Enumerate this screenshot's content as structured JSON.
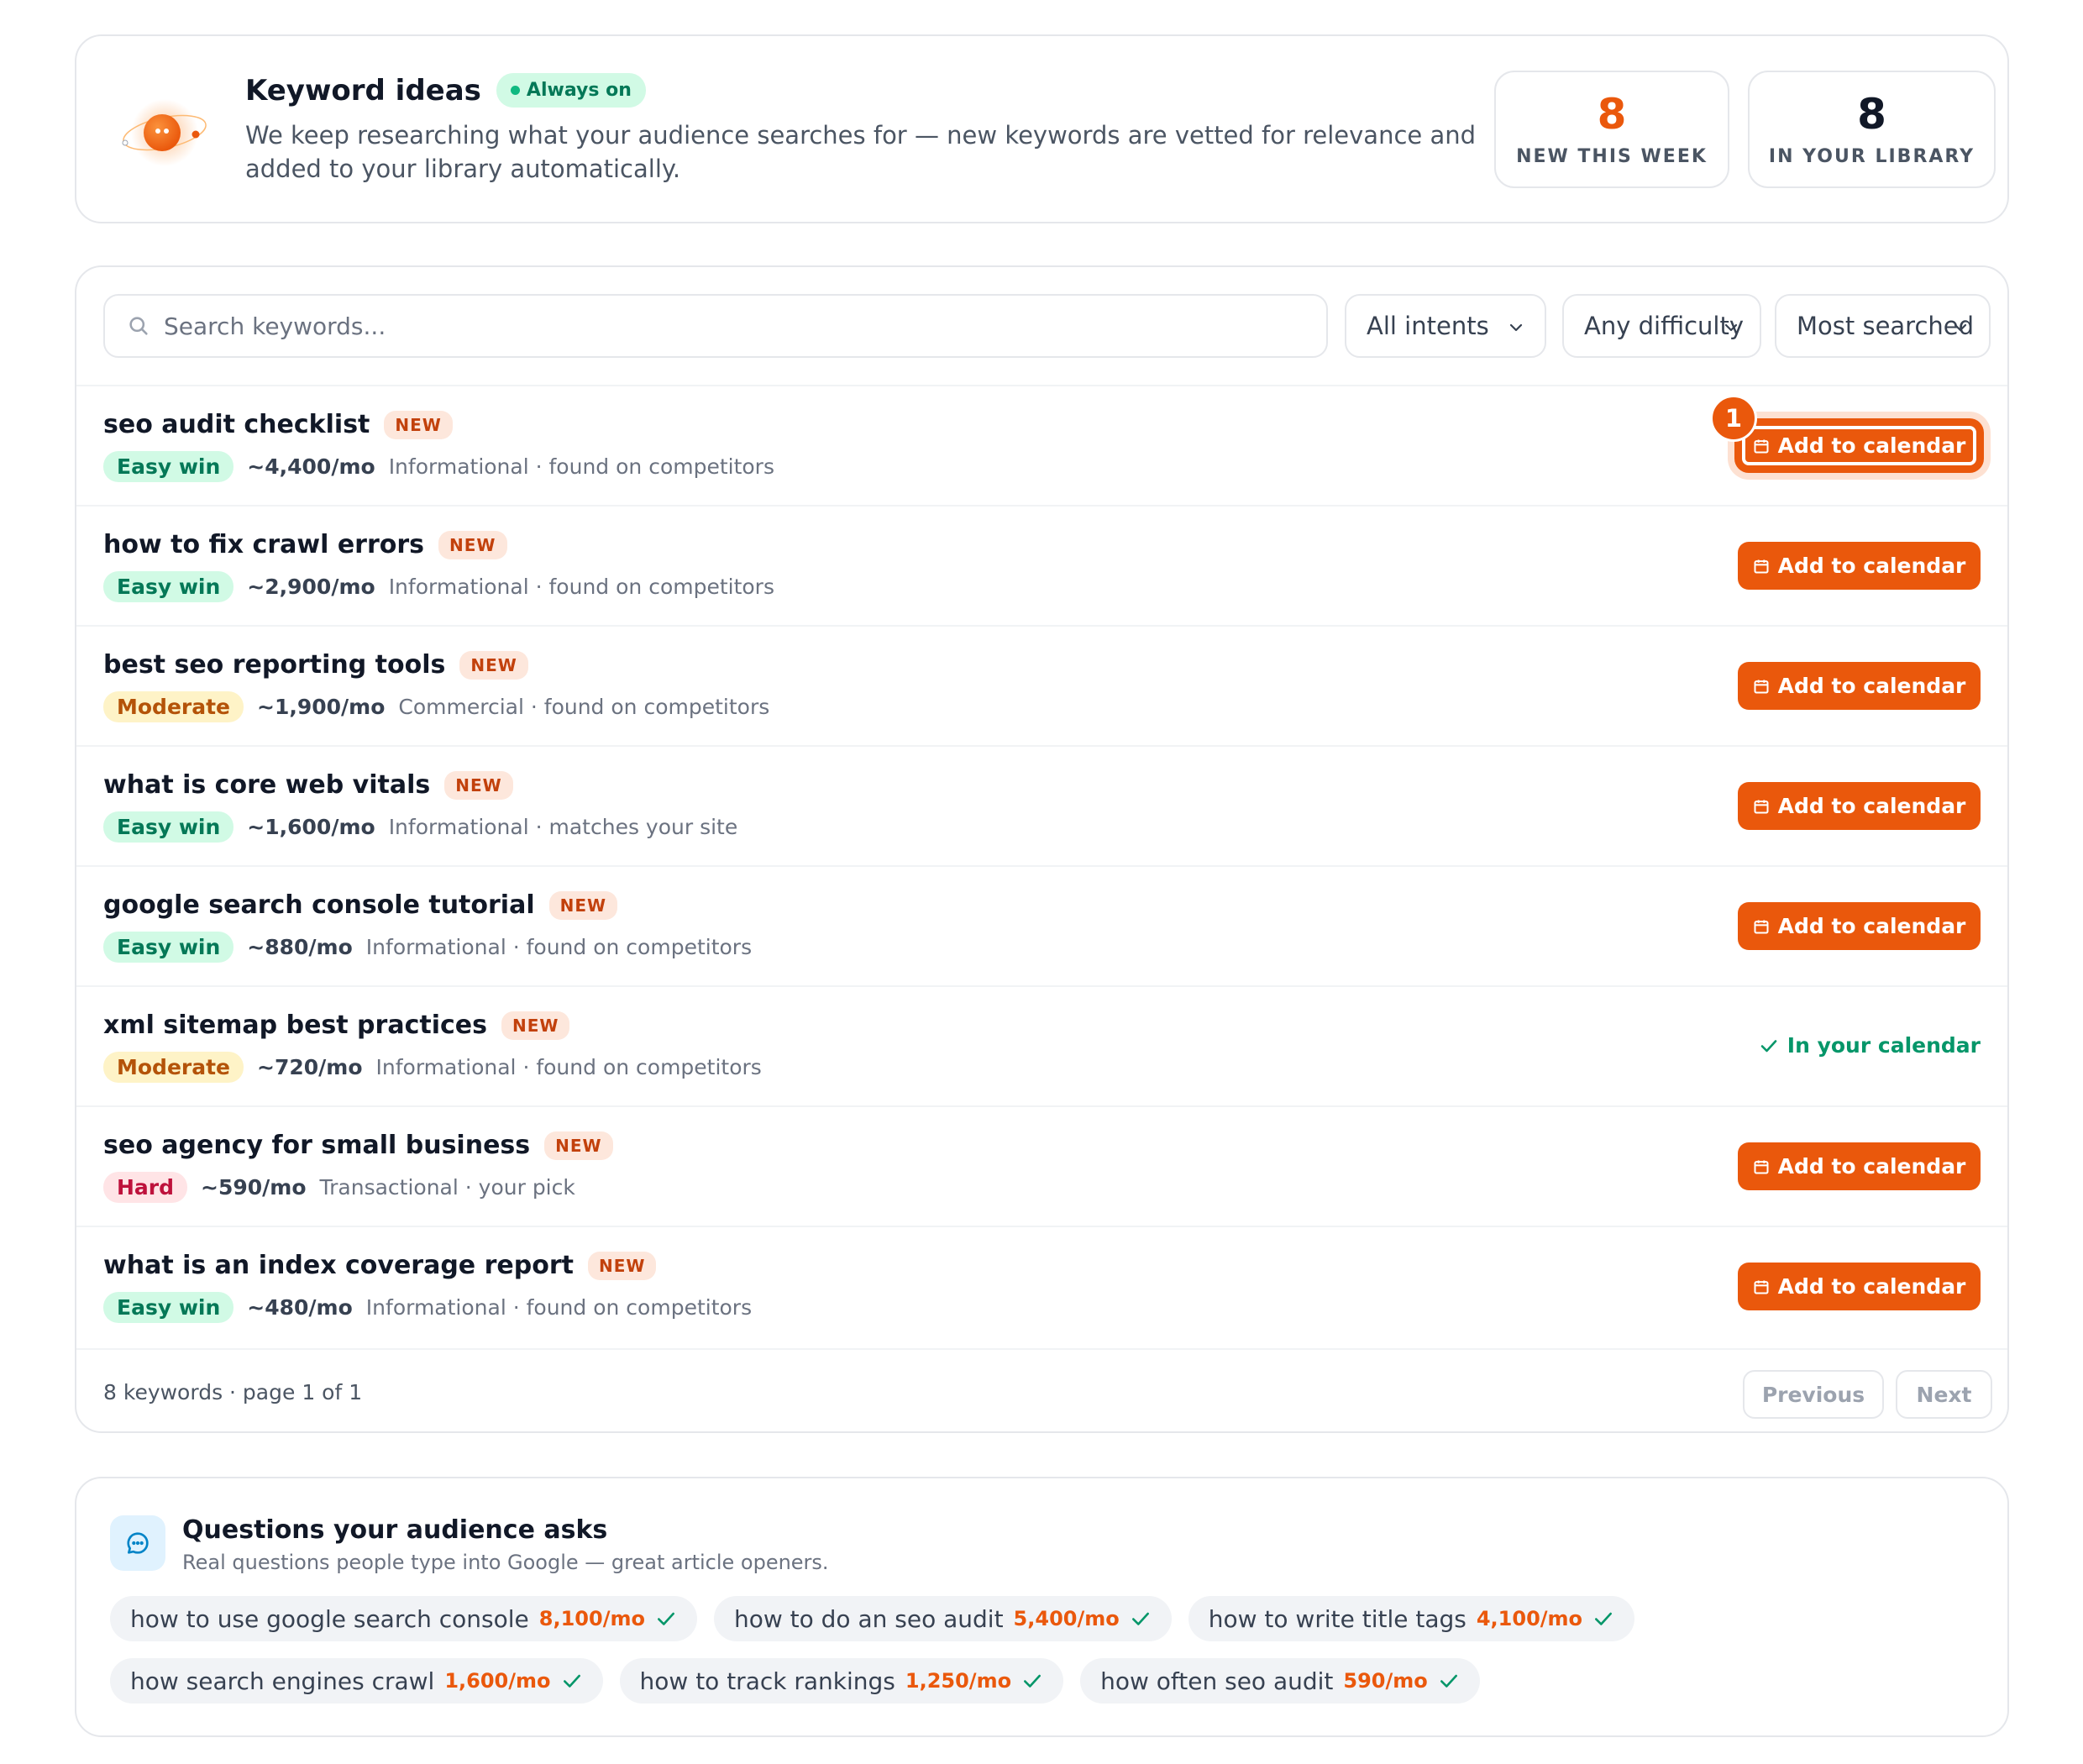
{
  "header": {
    "title": "Keyword ideas",
    "status_pill": "Always on",
    "description": "We keep researching what your audience searches for — new keywords are vetted for relevance and added to your library automatically.",
    "stats": [
      {
        "value": "8",
        "label": "NEW THIS WEEK",
        "color": "#ea580c"
      },
      {
        "value": "8",
        "label": "IN YOUR LIBRARY",
        "color": "#111827"
      }
    ]
  },
  "filters": {
    "search_placeholder": "Search keywords...",
    "intent": "All intents",
    "difficulty": "Any difficulty",
    "sort": "Most searched"
  },
  "keywords": [
    {
      "keyword": "seo audit checklist",
      "tag": "NEW",
      "difficulty": "Easy win",
      "level": "easy",
      "volume": "~4,400/mo",
      "meta": "Informational · found on competitors",
      "action": "Add to calendar",
      "badge": "1"
    },
    {
      "keyword": "how to fix crawl errors",
      "tag": "NEW",
      "difficulty": "Easy win",
      "level": "easy",
      "volume": "~2,900/mo",
      "meta": "Informational · found on competitors",
      "action": "Add to calendar"
    },
    {
      "keyword": "best seo reporting tools",
      "tag": "NEW",
      "difficulty": "Moderate",
      "level": "moderate",
      "volume": "~1,900/mo",
      "meta": "Commercial · found on competitors",
      "action": "Add to calendar"
    },
    {
      "keyword": "what is core web vitals",
      "tag": "NEW",
      "difficulty": "Easy win",
      "level": "easy",
      "volume": "~1,600/mo",
      "meta": "Informational · matches your site",
      "action": "Add to calendar"
    },
    {
      "keyword": "google search console tutorial",
      "tag": "NEW",
      "difficulty": "Easy win",
      "level": "easy",
      "volume": "~880/mo",
      "meta": "Informational · found on competitors",
      "action": "Add to calendar"
    },
    {
      "keyword": "xml sitemap best practices",
      "tag": "NEW",
      "difficulty": "Moderate",
      "level": "moderate",
      "volume": "~720/mo",
      "meta": "Informational · found on competitors",
      "status": "In your calendar"
    },
    {
      "keyword": "seo agency for small business",
      "tag": "NEW",
      "difficulty": "Hard",
      "level": "hard",
      "volume": "~590/mo",
      "meta": "Transactional · your pick",
      "action": "Add to calendar"
    },
    {
      "keyword": "what is an index coverage report",
      "tag": "NEW",
      "difficulty": "Easy win",
      "level": "easy",
      "volume": "~480/mo",
      "meta": "Informational · found on competitors",
      "action": "Add to calendar"
    }
  ],
  "pagination": {
    "summary": "8 keywords · page 1 of 1",
    "previous": "Previous",
    "next": "Next"
  },
  "questions": {
    "title": "Questions your audience asks",
    "subtitle": "Real questions people type into Google — great article openers.",
    "items": [
      {
        "text": "how to use google search console",
        "volume": "8,100/mo"
      },
      {
        "text": "how to do an seo audit",
        "volume": "5,400/mo"
      },
      {
        "text": "how to write title tags",
        "volume": "4,100/mo"
      },
      {
        "text": "how search engines crawl",
        "volume": "1,600/mo"
      },
      {
        "text": "how to track rankings",
        "volume": "1,250/mo"
      },
      {
        "text": "how often seo audit",
        "volume": "590/mo"
      }
    ]
  },
  "colors": {
    "accent": "#ea580c",
    "success": "#059669",
    "easy_bg": "#d1fae5",
    "moderate_bg": "#fef3c7",
    "hard_bg": "#ffe4e6"
  }
}
